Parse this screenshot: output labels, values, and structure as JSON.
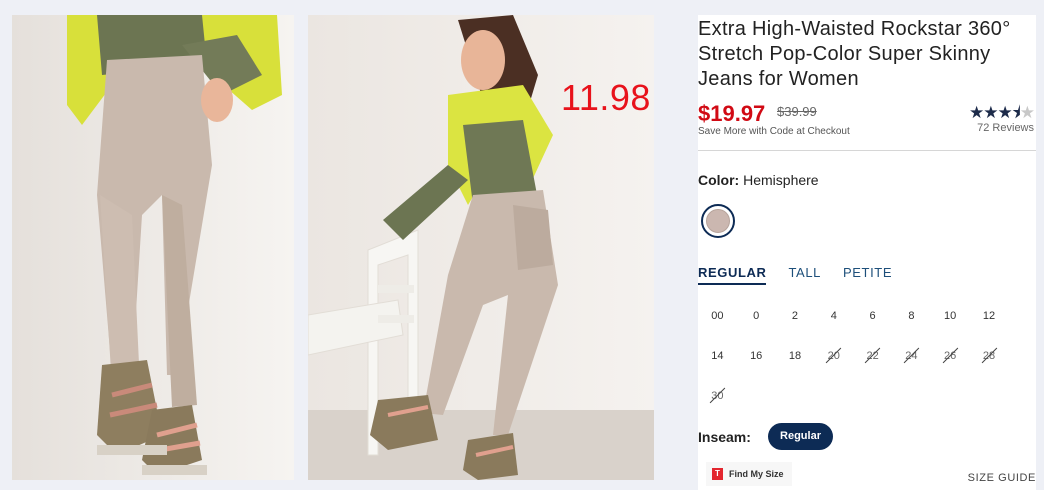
{
  "overlay": {
    "price_note": "11.98"
  },
  "product": {
    "title": "Extra High-Waisted Rockstar 360° Stretch Pop-Color Super Skinny Jeans for Women",
    "sale_price": "$19.97",
    "original_price": "$39.99",
    "promo": "Save More with Code at Checkout",
    "rating_stars": 3.5,
    "reviews": "72 Reviews"
  },
  "color": {
    "label": "Color:",
    "value": "Hemisphere",
    "swatch_hex": "#cbb7b0"
  },
  "fit_tabs": [
    {
      "label": "REGULAR",
      "active": true
    },
    {
      "label": "TALL",
      "active": false
    },
    {
      "label": "PETITE",
      "active": false
    }
  ],
  "sizes": [
    {
      "label": "00",
      "available": true
    },
    {
      "label": "0",
      "available": true
    },
    {
      "label": "2",
      "available": true
    },
    {
      "label": "4",
      "available": true
    },
    {
      "label": "6",
      "available": true
    },
    {
      "label": "8",
      "available": true
    },
    {
      "label": "10",
      "available": true
    },
    {
      "label": "12",
      "available": true
    },
    {
      "label": "14",
      "available": true
    },
    {
      "label": "16",
      "available": true
    },
    {
      "label": "18",
      "available": true
    },
    {
      "label": "20",
      "available": false
    },
    {
      "label": "22",
      "available": false
    },
    {
      "label": "24",
      "available": false
    },
    {
      "label": "26",
      "available": false
    },
    {
      "label": "28",
      "available": false
    },
    {
      "label": "30",
      "available": false
    }
  ],
  "inseam": {
    "label": "Inseam:",
    "selected": "Regular"
  },
  "find_my_size": {
    "logo": "T",
    "label": "Find My Size"
  },
  "size_guide": "SIZE GUIDE",
  "colors": {
    "navy": "#0d2b55",
    "sale_red": "#d10a14",
    "jacket_yellow": "#d6e23c",
    "jeans_taupe": "#c9b9ad"
  }
}
